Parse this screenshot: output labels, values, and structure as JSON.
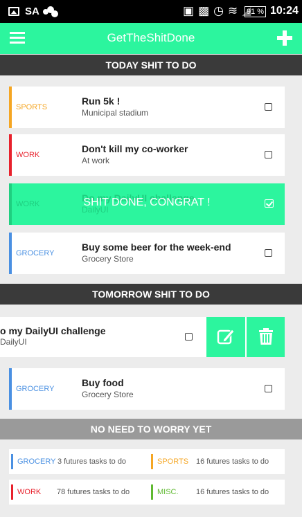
{
  "status_bar": {
    "carrier": "SA",
    "battery": "91 %",
    "time": "10:24",
    "icons": [
      "nfc-icon",
      "vibrate-icon",
      "alarm-icon",
      "wifi-icon",
      "signal-icon"
    ]
  },
  "app_bar": {
    "title": "GetTheShitDone",
    "menu_icon": "menu-icon",
    "add_icon": "plus-icon"
  },
  "colors": {
    "accent": "#2cf59e",
    "sports": "#f5a623",
    "work": "#e8212c",
    "grocery": "#4a90e2",
    "misc": "#5fb930"
  },
  "sections": {
    "today": "TODAY SHIT TO DO",
    "tomorrow": "TOMORROW SHIT TO DO",
    "later": "NO NEED TO WORRY YET"
  },
  "today_tasks": [
    {
      "tag": "SPORTS",
      "title": "Run 5k !",
      "place": "Municipal stadium"
    },
    {
      "tag": "WORK",
      "title": "Don't kill my co-worker",
      "place": "At work"
    },
    {
      "tag": "WORK",
      "title": "Do my DailyUI challenge",
      "place": "DailyUI",
      "done_message": "SHIT DONE, CONGRAT !"
    },
    {
      "tag": "GROCERY",
      "title": "Buy some beer for the week-end",
      "place": "Grocery Store"
    }
  ],
  "tomorrow_tasks": [
    {
      "title": "o my DailyUI challenge",
      "place": "DailyUI",
      "actions": [
        "edit-icon",
        "trash-icon"
      ]
    },
    {
      "tag": "GROCERY",
      "title": "Buy food",
      "place": "Grocery Store"
    }
  ],
  "future_tasks": [
    {
      "tag": "GROCERY",
      "count": "3 futures tasks to do"
    },
    {
      "tag": "SPORTS",
      "count": "16 futures tasks to do"
    },
    {
      "tag": "WORK",
      "count": "78 futures tasks to do"
    },
    {
      "tag": "MISC.",
      "count": "16 futures tasks to do"
    }
  ]
}
